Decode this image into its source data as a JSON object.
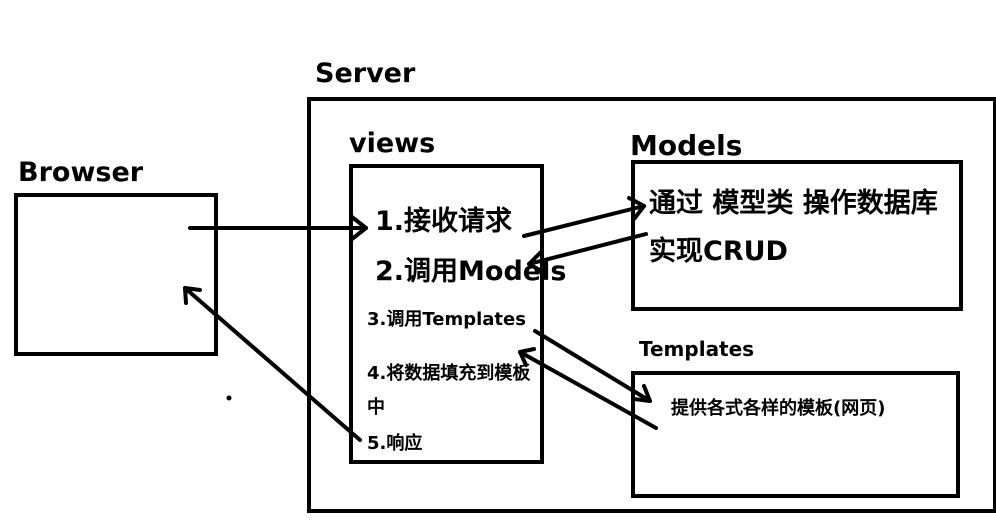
{
  "titles": {
    "server": "Server",
    "browser": "Browser",
    "views": "views",
    "models": "Models",
    "templates": "Templates"
  },
  "views_steps": {
    "step1": "1.接收请求",
    "step2": "2.调用Models",
    "step3": "3.调用Templates",
    "step4_line1": "4.将数据填充到模板",
    "step4_line2": "中",
    "step5": "5.响应"
  },
  "models_desc": {
    "line1": "通过 模型类 操作数据库",
    "line2": "实现CRUD"
  },
  "templates_desc": "提供各式各样的模板(网页)"
}
